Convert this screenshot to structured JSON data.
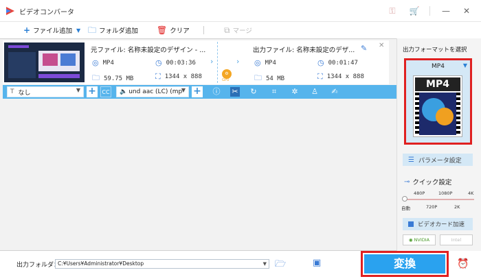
{
  "window": {
    "title": "ビデオコンバータ"
  },
  "toolbar": {
    "add_file": "ファイル追加",
    "add_folder": "フォルダ追加",
    "clear": "クリア",
    "merge": "マージ"
  },
  "video": {
    "source_title": "元ファイル: 名称未設定のデザイン - ...",
    "source_format": "MP4",
    "source_duration": "00:03:36",
    "source_size": "59.75 MB",
    "source_resolution": "1344 x 888",
    "output_title": "出力ファイル: 名称未設定のデザ...",
    "output_format": "MP4",
    "output_duration": "00:01:47",
    "output_size": "54 MB",
    "output_resolution": "1344 x 888",
    "gpu_label": "GPU"
  },
  "edit_bar": {
    "subtitle_value": "なし",
    "audio_value": "und aac (LC) (mp",
    "cc_label": "CC"
  },
  "right_panel": {
    "format_select_label": "出力フォーマットを選択",
    "format_name": "MP4",
    "format_icon_text": "MP4",
    "param_button": "パラメータ設定",
    "quick_label": "クイック設定",
    "quality_top": [
      "480P",
      "1080P",
      "4K"
    ],
    "quality_bottom": [
      "自動",
      "720P",
      "2K"
    ],
    "quick_level": 0,
    "gpu_accel": "ビデオカード加速",
    "vendor_nvidia": "NVIDIA",
    "vendor_intel": "Intel"
  },
  "bottom": {
    "output_folder_label": "出力フォルダ：",
    "output_path": "C:¥Users¥Administrator¥Desktop",
    "convert_label": "変換"
  },
  "colors": {
    "accent": "#2aa2ef",
    "edit_bar": "#56b4ec",
    "highlight": "#e02020"
  }
}
